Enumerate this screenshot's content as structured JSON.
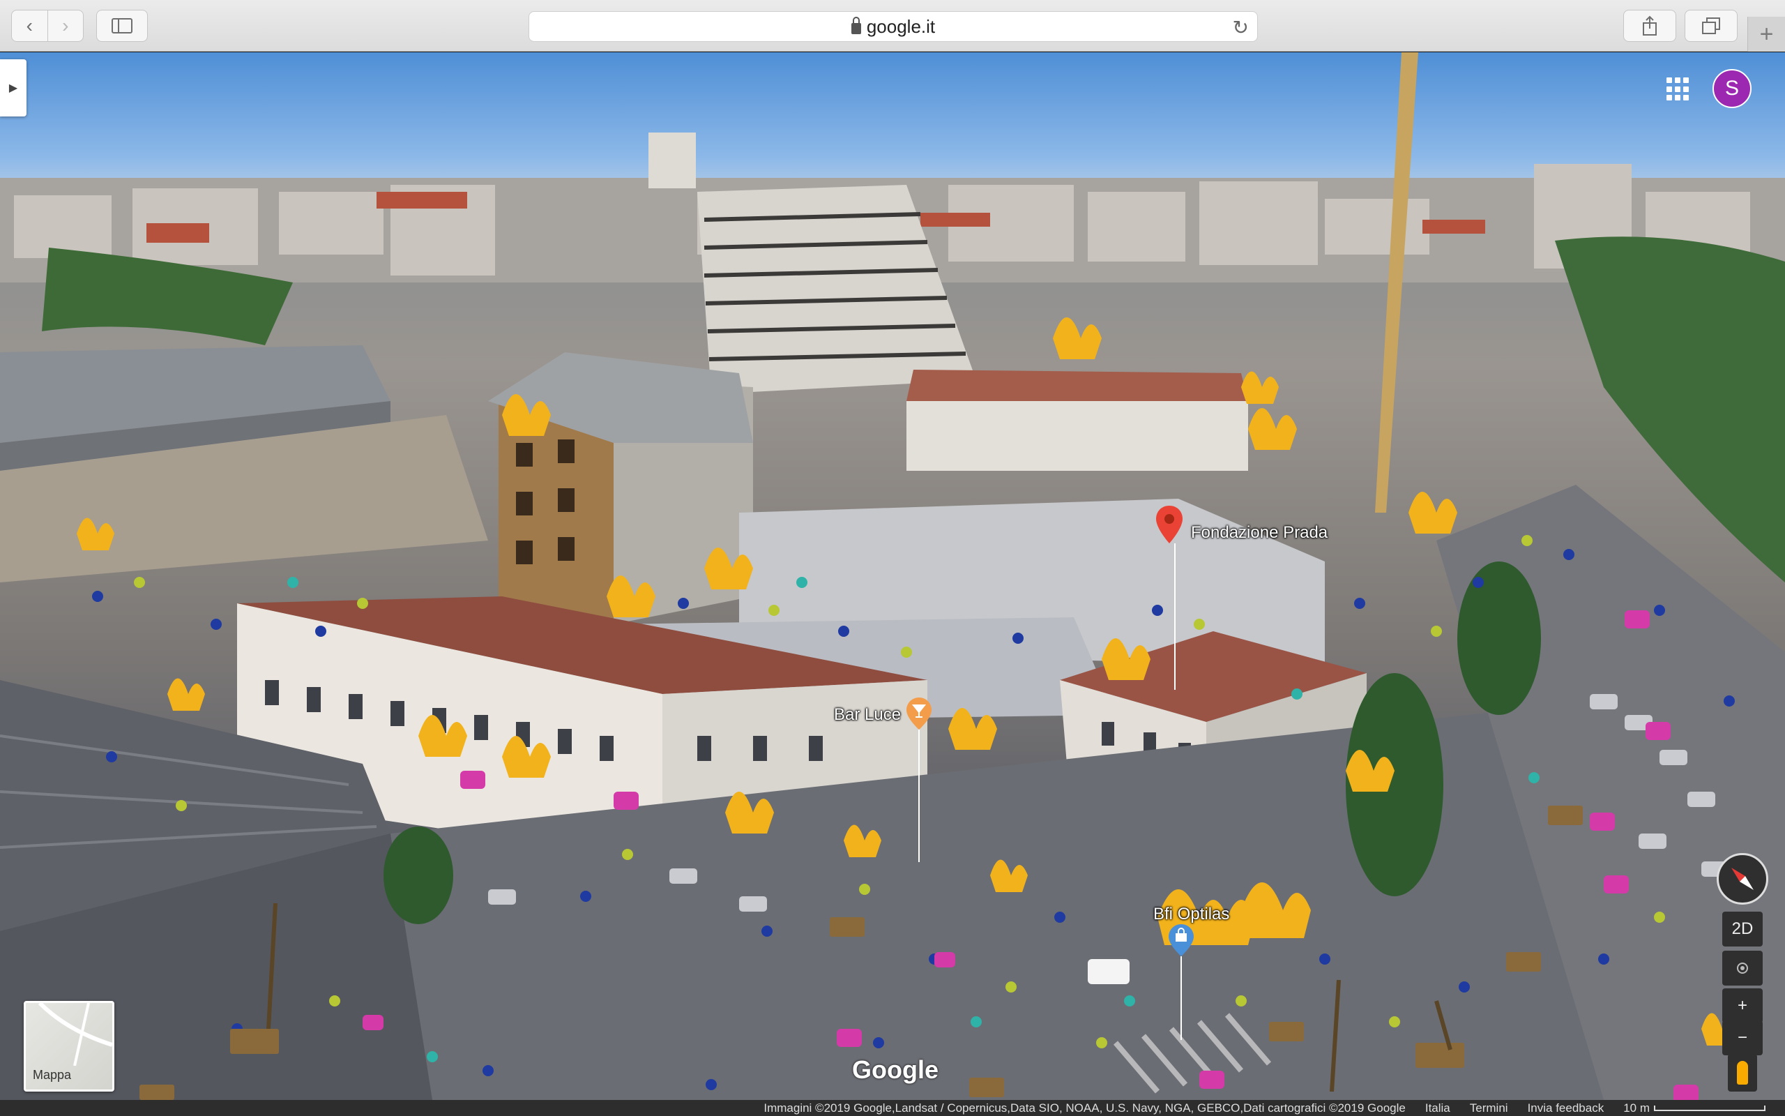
{
  "browser": {
    "back_icon": "chevron-left-icon",
    "forward_icon": "chevron-right-icon",
    "sidebar_icon": "sidebar-icon",
    "url": "google.it",
    "reload_icon": "reload-icon",
    "share_icon": "share-icon",
    "tabs_icon": "tabs-overview-icon",
    "new_tab_icon": "plus-icon",
    "new_tab_glyph": "+"
  },
  "header": {
    "apps_icon": "apps-grid-icon",
    "avatar_initial": "S",
    "avatar_color": "#9c27b0"
  },
  "places": [
    {
      "label": "Fondazione Prada",
      "icon": "red-pin-icon"
    },
    {
      "label": "Bar Luce",
      "icon": "bar-pin-icon"
    },
    {
      "label": "Bfi Optilas",
      "icon": "shopping-bag-pin-icon"
    }
  ],
  "controls": {
    "compass_icon": "compass-icon",
    "mode_2d_label": "2D",
    "my_location_icon": "my-location-icon",
    "zoom_in_label": "+",
    "zoom_out_label": "−",
    "pegman_icon": "pegman-icon"
  },
  "map_type": {
    "label": "Mappa"
  },
  "logo": "Google",
  "footer": {
    "attribution": "Immagini ©2019 Google,Landsat / Copernicus,Data SIO, NOAA, U.S. Navy, NGA, GEBCO,Dati cartografici ©2019 Google",
    "country": "Italia",
    "terms": "Termini",
    "feedback": "Invia feedback",
    "scale": "10 m"
  },
  "colors": {
    "pin_red": "#ea4335",
    "bar_orange": "#f39c4a",
    "shop_blue": "#4a90d9",
    "fire": "#f2b21c"
  }
}
